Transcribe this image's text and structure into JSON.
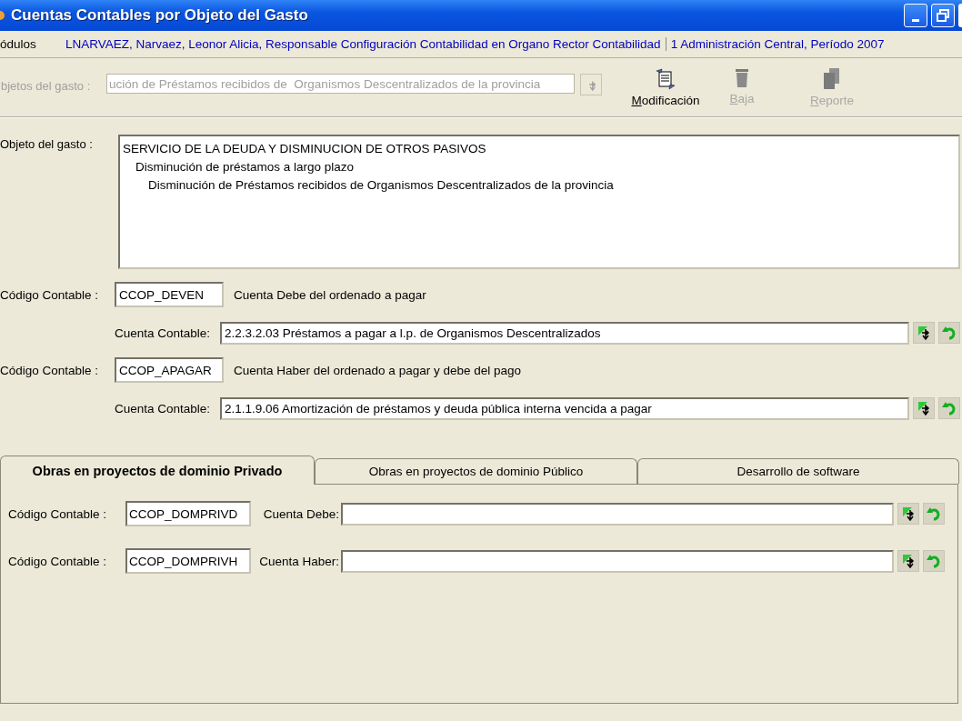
{
  "window": {
    "title": "Cuentas Contables por Objeto del Gasto"
  },
  "info_bar": {
    "module": "ódulos",
    "user": "LNARVAEZ, Narvaez, Leonor Alicia, Responsable Configuración Contabilidad en Organo Rector Contabilidad",
    "organization": "1 Administración Central, Período 2007"
  },
  "toolbar": {
    "search": {
      "label": "bjetos del gasto :",
      "value": "ución de Préstamos recibidos de  Organismos Descentralizados de la provincia",
      "disabled": true
    },
    "buttons": [
      {
        "kind": "edit",
        "label": "Modificación",
        "disabled": false
      },
      {
        "kind": "delete",
        "label": "Baja",
        "disabled": true
      },
      {
        "kind": "report",
        "label": "Reporte",
        "disabled": true
      }
    ]
  },
  "objeto_del_gasto": {
    "label": "Objeto del gasto :",
    "tree": [
      {
        "text": "SERVICIO DE LA DEUDA Y DISMINUCION DE OTROS PASIVOS",
        "children": [
          {
            "text": "Disminución de préstamos a largo plazo",
            "children": [
              {
                "text": "Disminución de Préstamos recibidos de  Organismos Descentralizados de la provincia"
              }
            ]
          }
        ]
      }
    ]
  },
  "cuentas": [
    {
      "codigo_label": "Código Contable :",
      "codigo": "CCOP_DEVEN",
      "description": "Cuenta Debe del ordenado a pagar",
      "cuenta_label": "Cuenta Contable:",
      "cuenta": "2.2.3.2.03 Préstamos a pagar a l.p. de Organismos Descentralizados"
    },
    {
      "codigo_label": "Código Contable :",
      "codigo": "CCOP_APAGAR",
      "description": "Cuenta Haber del ordenado a pagar y debe del pago",
      "cuenta_label": "Cuenta Contable:",
      "cuenta": "2.1.1.9.06 Amortización de préstamos y deuda pública interna vencida a pagar"
    }
  ],
  "tabs": [
    {
      "label": "Obras en proyectos de dominio Privado",
      "selected": true
    },
    {
      "label": "Obras en proyectos de dominio Público",
      "selected": false
    },
    {
      "label": "Desarrollo de software",
      "selected": false
    }
  ],
  "tab_panel": {
    "rows": [
      {
        "codigo_label": "Código Contable :",
        "codigo": "CCOP_DOMPRIVD",
        "cuenta_label": "Cuenta Debe:"
      },
      {
        "codigo_label": "Código Contable :",
        "codigo": "CCOP_DOMPRIVH",
        "cuenta_label": "Cuenta Haber:"
      }
    ]
  }
}
